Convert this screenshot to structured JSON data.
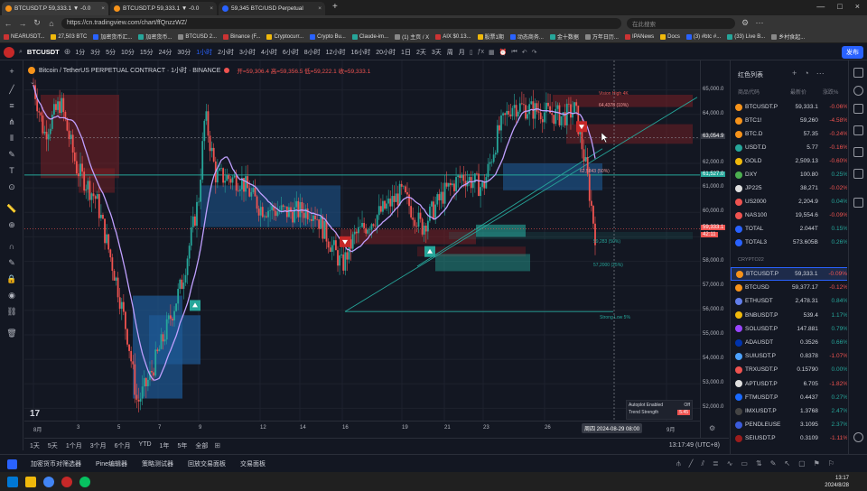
{
  "browser": {
    "tabs": [
      {
        "title": "BTCUSDT.P 59,333.1 ▼ -0.0"
      },
      {
        "title": "BTCUSDT.P 59,333.1 ▼ -0.0"
      },
      {
        "title": "59,345 BTC/USD Perpetual"
      }
    ],
    "new_tab": "+",
    "url": "https://cn.tradingview.com/chart/ffQnzzWZ/",
    "search_placeholder": "在此搜索",
    "bookmarks": [
      "NEARUSDT...",
      "27,503 BTC",
      "加密货币汇...",
      "加密货币...",
      "BTCUSD 2...",
      "Binance (F...",
      "Cryptocurr...",
      "Crypto Bu...",
      "Claude-im...",
      "(1) 主页 / X",
      "AIX $0.13...",
      "股票1期",
      "动态商务...",
      "金十数据",
      "万年日历...",
      "IPANews",
      "Docs",
      "(3) #btc #...",
      "(33) Live B...",
      "乡村食起..."
    ]
  },
  "toolbar": {
    "symbol": "BTCUSDT",
    "timeframes": [
      "1分",
      "3分",
      "5分",
      "10分",
      "15分",
      "24分",
      "30分",
      "1小时",
      "2小时",
      "3小时",
      "4小时",
      "6小时",
      "8小时",
      "12小时",
      "16小时",
      "20小时",
      "1日",
      "2天",
      "3天",
      "周",
      "月"
    ],
    "selected": "1小时",
    "publish": "发布"
  },
  "chart": {
    "title": "Bitcoin / TetherUS PERPETUAL CONTRACT · 1小时 · BINANCE",
    "ohlc": "开=59,306.4  高=59,356.5  低=59,222.1  收=59,333.1",
    "price_labels": [
      "65,000.0",
      "64,000.0",
      "63,054.9",
      "62,000.0",
      "61,000.0",
      "60,000.0",
      "59,333.1",
      "58,000.0",
      "57,000.0",
      "56,000.0",
      "55,000.0",
      "54,000.0",
      "53,000.0",
      "52,000.0"
    ],
    "current_price": "59,333.1",
    "countdown": "42:11",
    "price_level_tag": "61,527.0",
    "time_labels": [
      "8月",
      "3",
      "5",
      "7",
      "9",
      "12",
      "14",
      "16",
      "19",
      "21",
      "23",
      "26",
      "9月"
    ],
    "crosshair_time": "周四 2024-08-29  08:00",
    "annotations": {
      "vision": "Vision High 4K",
      "fib_1": "64,4378 (10%)",
      "fib_2": "62,5843 (50%)",
      "fib_3": "59,283 (50%)",
      "fib_4": "57,2000 (25%)",
      "strong_low": "Strong Low 5%"
    },
    "legend": {
      "item1": "Autoplot Enabled",
      "item1_val": "Off",
      "item2": "Trend Strength",
      "item2_val": "5.45"
    },
    "colors": {
      "bull": "#26a69a",
      "bear": "#ef5350",
      "ma": "#c0a0ff",
      "bg": "#131722",
      "supply": "#7a1f24",
      "demand": "#1e5a96"
    }
  },
  "chart_data": {
    "type": "line",
    "x_label": "time (1h)",
    "x": [
      "8月",
      "3",
      "5",
      "7",
      "9",
      "12",
      "14",
      "16",
      "19",
      "21",
      "23",
      "26",
      "28"
    ],
    "series": [
      {
        "name": "BTCUSDT.P",
        "values": [
          65200,
          62500,
          54500,
          49800,
          61400,
          59800,
          60200,
          58800,
          59500,
          61300,
          64700,
          64000,
          59333
        ]
      }
    ],
    "ylim": [
      51500,
      66200
    ]
  },
  "range": {
    "items": [
      "1天",
      "5天",
      "1个月",
      "3个月",
      "6个月",
      "YTD",
      "1年",
      "5年",
      "全部"
    ],
    "clock": "13:17:49 (UTC+8)"
  },
  "bottom_tabs": [
    "加密货币对筛选器",
    "Pine编辑器",
    "策略测试器",
    "回放交易面板",
    "交易面板"
  ],
  "watchlist": {
    "title": "红色列表",
    "headers": {
      "symbol": "商品代码",
      "last": "最新价",
      "change": "涨跌%"
    },
    "section": "CRYPTO22",
    "rows": [
      {
        "s": "BTCUSDT.P",
        "p": "59,333.1",
        "c": "-0.06%",
        "d": "dn",
        "col": "#f7931a"
      },
      {
        "s": "BTC1!",
        "p": "59,260",
        "c": "-4.58%",
        "d": "dn",
        "col": "#f7931a"
      },
      {
        "s": "BTC.D",
        "p": "57.35",
        "c": "-0.24%",
        "d": "dn",
        "col": "#f7931a"
      },
      {
        "s": "USDT.D",
        "p": "5.77",
        "c": "-0.16%",
        "d": "dn",
        "col": "#26a69a"
      },
      {
        "s": "GOLD",
        "p": "2,509.13",
        "c": "-0.60%",
        "d": "dn",
        "col": "#f0b90b"
      },
      {
        "s": "DXY",
        "p": "100.80",
        "c": "0.25%",
        "d": "up",
        "col": "#4caf50"
      },
      {
        "s": "JP225",
        "p": "38,271",
        "c": "-0.02%",
        "d": "dn",
        "col": "#e0e0e0"
      },
      {
        "s": "US2000",
        "p": "2,204.9",
        "c": "0.04%",
        "d": "up",
        "col": "#ef5350"
      },
      {
        "s": "NAS100",
        "p": "19,554.6",
        "c": "-0.09%",
        "d": "dn",
        "col": "#ef5350"
      },
      {
        "s": "TOTAL",
        "p": "2.044T",
        "c": "0.15%",
        "d": "up",
        "col": "#2962ff"
      },
      {
        "s": "TOTAL3",
        "p": "573.605B",
        "c": "0.26%",
        "d": "up",
        "col": "#2962ff"
      },
      {
        "s": "BTCUSDT.P",
        "p": "59,333.1",
        "c": "-0.09%",
        "d": "dn",
        "col": "#f7931a",
        "sel": true
      },
      {
        "s": "BTCUSD",
        "p": "59,377.17",
        "c": "-0.12%",
        "d": "dn",
        "col": "#f7931a"
      },
      {
        "s": "ETHUSDT",
        "p": "2,478.31",
        "c": "0.84%",
        "d": "up",
        "col": "#627eea"
      },
      {
        "s": "BNBUSDT.P",
        "p": "539.4",
        "c": "1.17%",
        "d": "up",
        "col": "#f0b90b"
      },
      {
        "s": "SOLUSDT.P",
        "p": "147.881",
        "c": "0.79%",
        "d": "up",
        "col": "#9945ff"
      },
      {
        "s": "ADAUSDT",
        "p": "0.3526",
        "c": "0.66%",
        "d": "up",
        "col": "#0033ad"
      },
      {
        "s": "SUIUSDT.P",
        "p": "0.8378",
        "c": "-1.07%",
        "d": "dn",
        "col": "#4da2ff"
      },
      {
        "s": "TRXUSDT.P",
        "p": "0.15790",
        "c": "0.00%",
        "d": "up",
        "col": "#ef5350"
      },
      {
        "s": "APTUSDT.P",
        "p": "6.705",
        "c": "-1.82%",
        "d": "dn",
        "col": "#e0e0e0"
      },
      {
        "s": "FTMUSDT.P",
        "p": "0.4437",
        "c": "0.27%",
        "d": "up",
        "col": "#1969ff"
      },
      {
        "s": "IMXUSDT.P",
        "p": "1.3768",
        "c": "2.47%",
        "d": "up",
        "col": "#444"
      },
      {
        "s": "PENDLEUSE",
        "p": "3.1095",
        "c": "2.37%",
        "d": "up",
        "col": "#3b5bdb"
      },
      {
        "s": "SEIUSDT.P",
        "p": "0.3109",
        "c": "-1.11%",
        "d": "dn",
        "col": "#9b1c1c"
      }
    ]
  },
  "taskbar": {
    "time": "13:17",
    "date": "2024/8/28"
  }
}
